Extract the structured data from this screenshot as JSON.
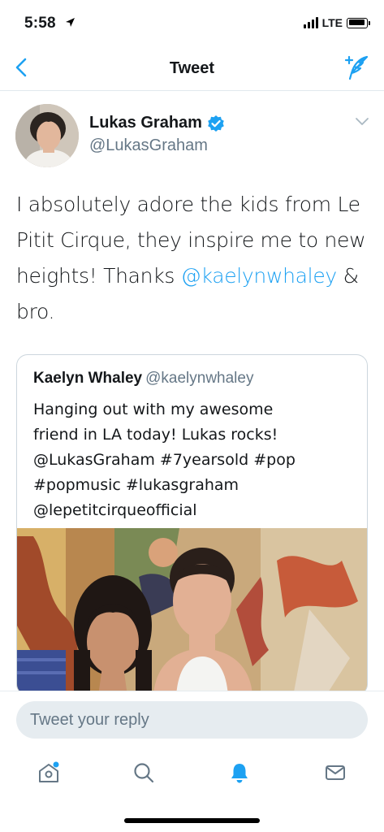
{
  "status_bar": {
    "time": "5:58",
    "network": "LTE",
    "icons": [
      "location-arrow-icon",
      "signal-icon",
      "battery-icon"
    ]
  },
  "nav": {
    "title": "Tweet",
    "back_icon": "chevron-left-icon",
    "compose_icon": "compose-tweet-icon"
  },
  "tweet": {
    "author_name": "Lukas Graham",
    "author_handle": "@LukasGraham",
    "verified": true,
    "text_part1": "I absolutely adore the kids from Le Pitit Cirque, they inspire me to new heights! Thanks ",
    "mention": "@kaelynwhaley",
    "text_part2": " & bro.",
    "quoted": {
      "author_name": "Kaelyn Whaley",
      "author_handle": "@kaelynwhaley",
      "text": "Hanging out with my awesome\nfriend in LA today!  Lukas rocks!\n@LukasGraham #7yearsold #pop\n#popmusic #lukasgraham\n@lepetitcirqueofficial"
    }
  },
  "reply": {
    "placeholder": "Tweet your reply"
  },
  "tab_bar": {
    "tabs": [
      "home-icon",
      "search-icon",
      "notifications-bell-icon",
      "messages-envelope-icon"
    ],
    "active": "notifications-bell-icon",
    "has_new_on_home": true
  },
  "colors": {
    "accent": "#1da1f2",
    "text": "#14171a",
    "secondary_text": "#657786",
    "border": "#e1e8ed",
    "reply_background": "#e6ecf0"
  }
}
